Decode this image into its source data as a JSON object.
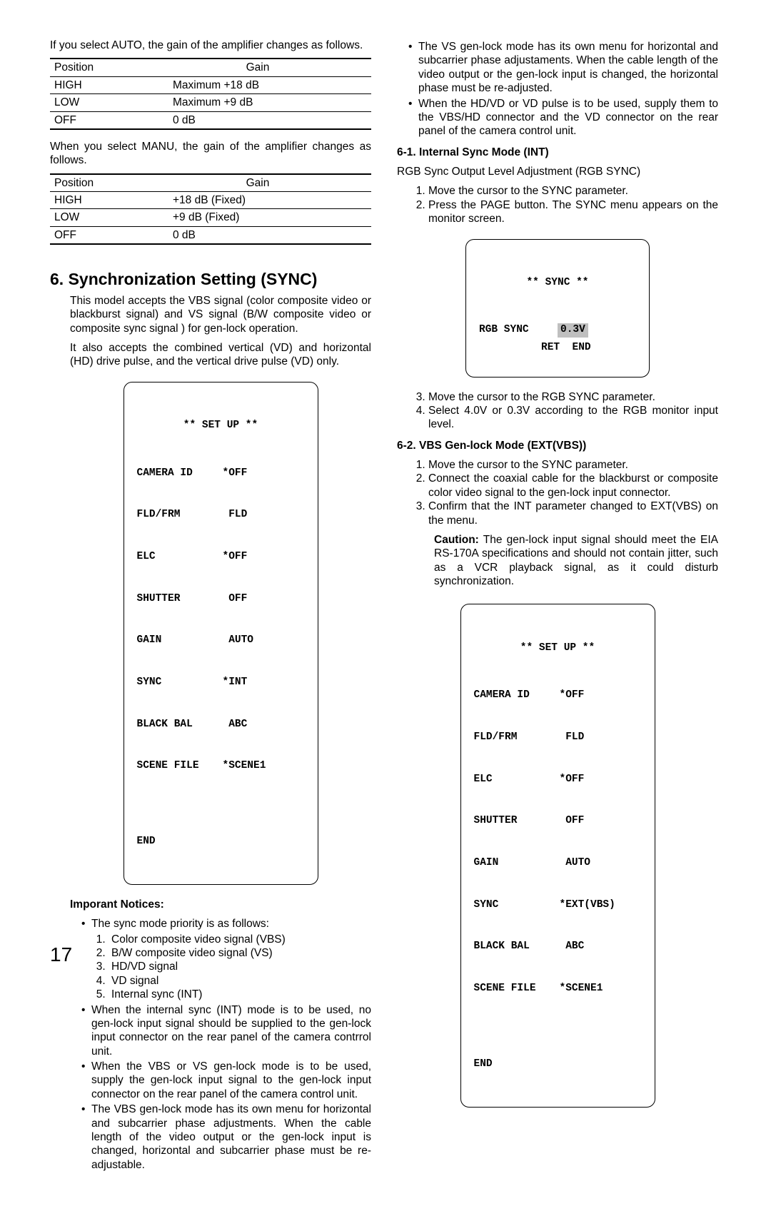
{
  "left": {
    "intro_auto": "If you select AUTO, the gain of the amplifier changes as follows.",
    "table_auto": {
      "h1": "Position",
      "h2": "Gain",
      "rows": [
        {
          "p": "HIGH",
          "g": "Maximum +18 dB"
        },
        {
          "p": "LOW",
          "g": "Maximum  +9 dB"
        },
        {
          "p": "OFF",
          "g": "0 dB"
        }
      ]
    },
    "intro_manu": "When you select MANU, the gain of the amplifier changes as follows.",
    "table_manu": {
      "h1": "Position",
      "h2": "Gain",
      "rows": [
        {
          "p": "HIGH",
          "g": "+18 dB (Fixed)"
        },
        {
          "p": "LOW",
          "g": "+9 dB (Fixed)"
        },
        {
          "p": "OFF",
          "g": "0 dB"
        }
      ]
    },
    "section_title": "6. Synchronization Setting (SYNC)",
    "section_p1": "This model accepts the VBS signal (color composite video or blackburst signal) and VS signal (B/W composite video or composite sync signal ) for gen-lock operation.",
    "section_p2": "It also accepts the combined vertical (VD) and horizontal (HD) drive pulse, and the vertical drive pulse (VD) only.",
    "osd_setup1": {
      "title": "** SET UP **",
      "rows": [
        {
          "k": "CAMERA ID",
          "v": "*OFF"
        },
        {
          "k": "FLD/FRM",
          "v": " FLD"
        },
        {
          "k": "ELC",
          "v": "*OFF"
        },
        {
          "k": "SHUTTER",
          "v": " OFF"
        },
        {
          "k": "GAIN",
          "v": " AUTO"
        },
        {
          "k": "SYNC",
          "v": "*INT"
        },
        {
          "k": "BLACK BAL",
          "v": " ABC"
        },
        {
          "k": "SCENE FILE",
          "v": "*SCENE1"
        }
      ],
      "end": "END"
    },
    "notices_title": "Imporant Notices:",
    "notice_priority": "The sync mode priority is as follows:",
    "priority_list": [
      "Color composite video signal (VBS)",
      "B/W composite video signal (VS)",
      "HD/VD signal",
      "VD signal",
      "Internal sync (INT)"
    ],
    "notice2": "When the internal sync (INT) mode is to be used, no gen-lock input signal should be supplied to the gen-lock input connector on the rear panel of the camera contrrol unit.",
    "notice3": "When the VBS or VS gen-lock mode is to be used, supply the gen-lock input signal to the gen-lock input connector on the rear panel of the camera control unit.",
    "notice4": "The VBS gen-lock mode has its own menu for horizontal and subcarrier phase adjustments. When the cable length of the video output or the gen-lock input is changed, horizontal and subcarrier phase must be re-adjustable."
  },
  "right": {
    "bullet1": "The VS gen-lock mode has its own menu for horizontal and subcarrier phase adjustaments. When the cable length of the video output or the gen-lock input is changed, the horizontal phase must be re-adjusted.",
    "bullet2": "When the HD/VD or VD pulse is to be used, supply them to the VBS/HD connector and the VD connector on the rear panel of the camera control unit.",
    "h61": "6-1. Internal Sync Mode (INT)",
    "h61_sub": "RGB Sync Output Level Adjustment (RGB SYNC)",
    "h61_s1": "Move the cursor to the SYNC parameter.",
    "h61_s2": "Press the PAGE button. The SYNC menu appears on the monitor screen.",
    "osd_sync": {
      "title": "** SYNC **",
      "k": "RGB SYNC",
      "v": "0.3V",
      "ret": "RET",
      "end": "END"
    },
    "h61_s3": "Move the cursor to the RGB SYNC parameter.",
    "h61_s4": "Select 4.0V or 0.3V according to the RGB monitor input level.",
    "h62": "6-2. VBS Gen-lock Mode (EXT(VBS))",
    "h62_s1": "Move the cursor to the SYNC parameter.",
    "h62_s2": "Connect the coaxial cable for the blackburst or composite color video signal to the gen-lock input connector.",
    "h62_s3": "Confirm that the INT parameter changed to EXT(VBS) on the menu.",
    "caution_label": "Caution:",
    "caution_text": " The gen-lock input signal should meet the EIA RS-170A specifications and should not contain jitter, such as a VCR playback signal, as it could disturb synchronization.",
    "osd_setup2": {
      "title": "** SET UP **",
      "rows": [
        {
          "k": "CAMERA ID",
          "v": "*OFF"
        },
        {
          "k": "FLD/FRM",
          "v": " FLD"
        },
        {
          "k": "ELC",
          "v": "*OFF"
        },
        {
          "k": "SHUTTER",
          "v": " OFF"
        },
        {
          "k": "GAIN",
          "v": " AUTO"
        },
        {
          "k": "SYNC",
          "v": "*EXT(VBS)"
        },
        {
          "k": "BLACK BAL",
          "v": " ABC"
        },
        {
          "k": "SCENE FILE",
          "v": "*SCENE1"
        }
      ],
      "end": "END"
    }
  },
  "page_number": "17"
}
